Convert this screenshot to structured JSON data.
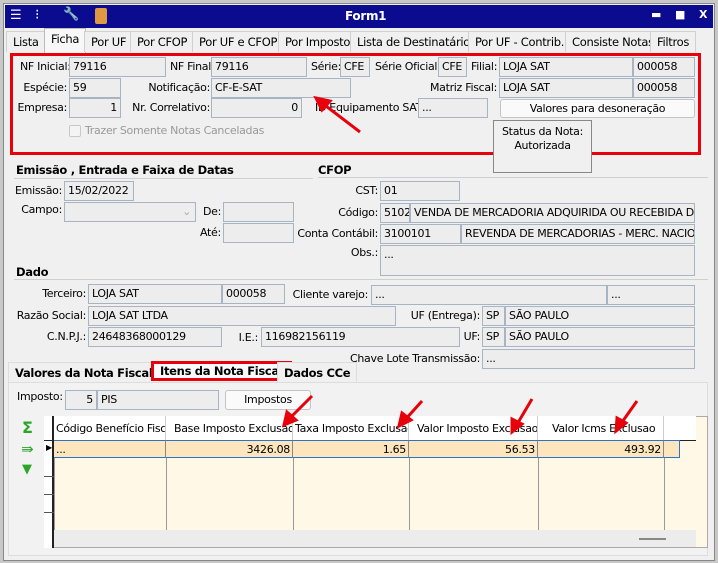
{
  "window": {
    "title": "Form1",
    "controls": [
      "▬",
      "■",
      "X"
    ]
  },
  "tabs": [
    "Lista",
    "Ficha",
    "Por UF",
    "Por CFOP",
    "Por UF e CFOP",
    "Por Imposto",
    "Lista de Destinatários",
    "Por UF - Contrib.",
    "Consiste Notas",
    "Filtros"
  ],
  "active_tab": "Ficha",
  "header": {
    "nf_inicial_label": "NF Inicial:",
    "nf_inicial": "79116",
    "nf_final_label": "NF Final:",
    "nf_final": "79116",
    "serie_label": "Série:",
    "serie": "CFE",
    "serie_oficial_label": "Série Oficial:",
    "serie_oficial": "CFE",
    "filial_label": "Filial:",
    "filial_nome": "LOJA SAT",
    "filial_codigo": "000058",
    "especie_label": "Espécie:",
    "especie": "59",
    "notificacao_label": "Notificação:",
    "notificacao": "CF-E-SAT",
    "matriz_label": "Matriz Fiscal:",
    "matriz_nome": "LOJA SAT",
    "matriz_codigo": "000058",
    "empresa_label": "Empresa:",
    "empresa": "1",
    "correlativo_label": "Nr. Correlativo:",
    "correlativo": "0",
    "equip_label": "ID Equipamento SAT:",
    "equip": "...",
    "desoneracao_button": "Valores para desoneração",
    "canceladas_label": "Trazer Somente Notas Canceladas",
    "canceladas_checked": false,
    "status_label": "Status da Nota:",
    "status_value": "Autorizada"
  },
  "datas": {
    "title": "Emissão , Entrada e Faixa de Datas",
    "emissao_label": "Emissão:",
    "emissao": "15/02/2022",
    "campo_label": "Campo:",
    "campo": "",
    "de_label": "De:",
    "de": "",
    "ate_label": "Até:",
    "ate": ""
  },
  "cfop": {
    "title": "CFOP",
    "cst_label": "CST:",
    "cst": "01",
    "codigo_label": "Código:",
    "codigo": "5102",
    "codigo_desc": "VENDA DE MERCADORIA ADQUIRIDA OU RECEBIDA DE TE",
    "conta_label": "Conta Contábil:",
    "conta": "3100101",
    "conta_desc": "REVENDA DE MERCADORIAS - MERC. NACIONAI",
    "obs_label": "Obs.:",
    "obs": "..."
  },
  "dados": {
    "title": "Dado",
    "terceiro_label": "Terceiro:",
    "terceiro": "LOJA SAT",
    "terceiro_codigo": "000058",
    "cliente_label": "Cliente varejo:",
    "cliente": "...",
    "cliente_codigo": "...",
    "razao_label": "Razão Social:",
    "razao": "LOJA SAT LTDA",
    "uf_entrega_label": "UF (Entrega):",
    "uf_entrega": "SP",
    "uf_entrega_nome": "SÃO PAULO",
    "cnpj_label": "C.N.P.J.:",
    "cnpj": "24648368000129",
    "ie_label": "I.E.:",
    "ie": "116982156119",
    "uf_label": "UF:",
    "uf": "SP",
    "uf_nome": "SÃO PAULO",
    "chave_label": "Chave Lote Transmissão:",
    "chave": "..."
  },
  "bottom_tabs": [
    "Valores da Nota Fiscal",
    "Itens da Nota Fiscal",
    "Dados CCe"
  ],
  "bottom_active": "Itens da Nota Fiscal",
  "imposto": {
    "label": "Imposto:",
    "codigo": "5",
    "nome": "PIS",
    "button": "Impostos"
  },
  "grid": {
    "columns": [
      "Código Benefício Fiscal",
      "Base Imposto Exclusao",
      "Taxa Imposto Exclusao",
      "Valor Imposto Exclusao",
      "Valor Icms Exclusao"
    ],
    "rows": [
      [
        "...",
        "3426.08",
        "1.65",
        "56.53",
        "493.92"
      ]
    ]
  },
  "colors": {
    "title_bar": "#0b0b8f",
    "highlight": "#ff0000",
    "selected_row": "#fde6bd",
    "grid_bg": "#fff8e6"
  }
}
